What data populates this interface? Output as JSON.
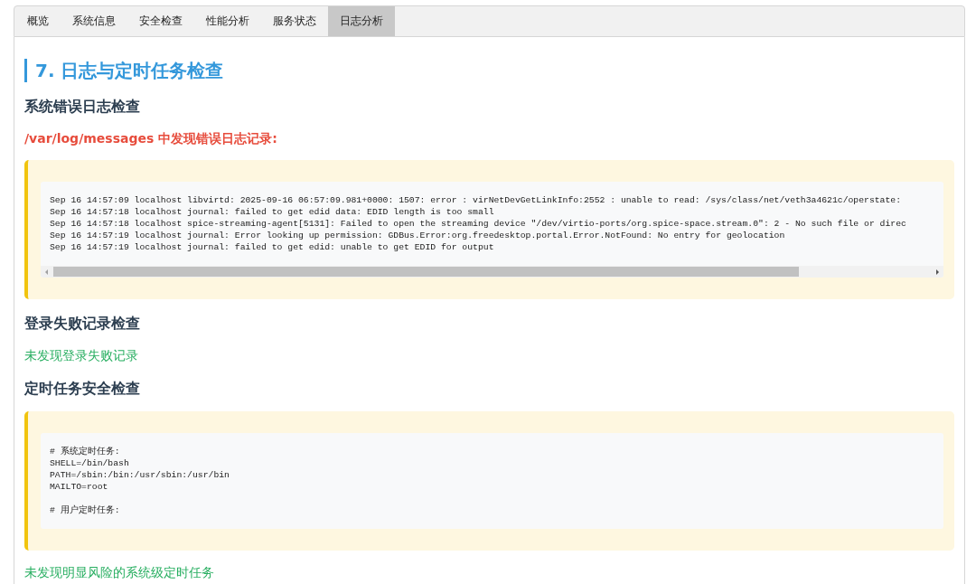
{
  "tabs": [
    {
      "label": "概览",
      "selected": false
    },
    {
      "label": "系统信息",
      "selected": false
    },
    {
      "label": "安全检查",
      "selected": false
    },
    {
      "label": "性能分析",
      "selected": false
    },
    {
      "label": "服务状态",
      "selected": false
    },
    {
      "label": "日志分析",
      "selected": true
    }
  ],
  "content": [
    {
      "kind": "title",
      "text": "7. 日志与定时任务检查"
    },
    {
      "kind": "heading",
      "text": "系统错误日志检查"
    },
    {
      "kind": "error",
      "text": "/var/log/messages 中发现错误日志记录:"
    },
    {
      "kind": "code",
      "scrollbar": true,
      "groups": [
        [
          "Sep 16 14:57:09 localhost libvirtd: 2025-09-16 06:57:09.981+0000: 1507: error : virNetDevGetLinkInfo:2552 : unable to read: /sys/class/net/veth3a4621c/operstate:",
          "Sep 16 14:57:18 localhost journal: failed to get edid data: EDID length is too small",
          "Sep 16 14:57:18 localhost spice-streaming-agent[5131]: Failed to open the streaming device \"/dev/virtio-ports/org.spice-space.stream.0\": 2 - No such file or direc",
          "Sep 16 14:57:19 localhost journal: Error looking up permission: GDBus.Error:org.freedesktop.portal.Error.NotFound: No entry for geolocation",
          "Sep 16 14:57:19 localhost journal: failed to get edid: unable to get EDID for output"
        ]
      ]
    },
    {
      "kind": "heading",
      "text": "登录失败记录检查"
    },
    {
      "kind": "success",
      "text": "未发现登录失败记录"
    },
    {
      "kind": "heading",
      "text": "定时任务安全检查"
    },
    {
      "kind": "code",
      "scrollbar": false,
      "groups": [
        [
          "# 系统定时任务:",
          "SHELL=/bin/bash",
          "PATH=/sbin:/bin:/usr/sbin:/usr/bin",
          "MAILTO=root"
        ],
        [
          "# 用户定时任务:"
        ]
      ]
    },
    {
      "kind": "success",
      "text": "未发现明显风险的系统级定时任务"
    }
  ]
}
